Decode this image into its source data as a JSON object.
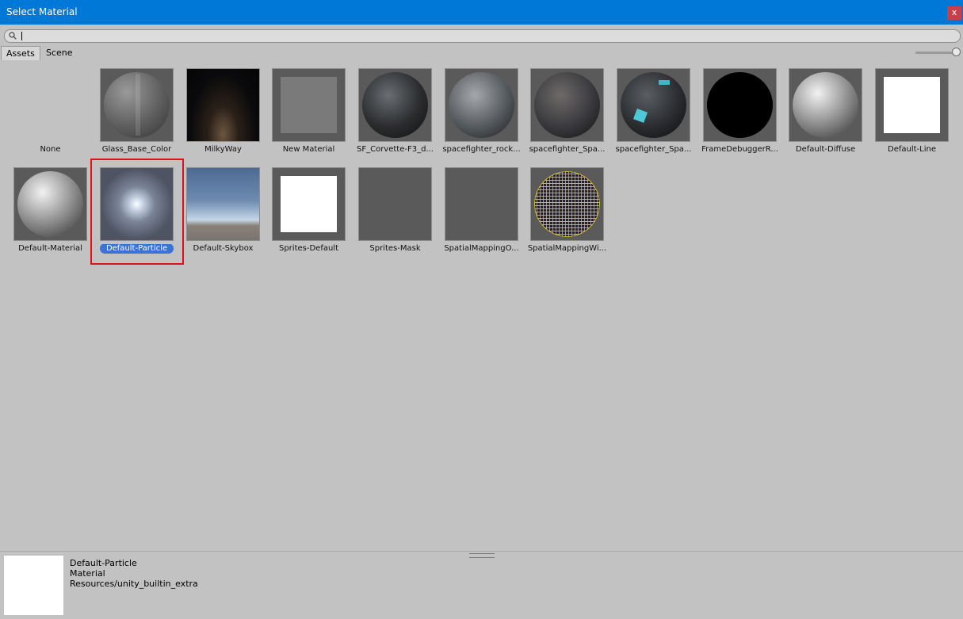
{
  "window": {
    "title": "Select Material",
    "close_label": "x"
  },
  "search": {
    "value": "",
    "placeholder": ""
  },
  "tabs": [
    {
      "label": "Assets",
      "active": true
    },
    {
      "label": "Scene",
      "active": false
    }
  ],
  "zoom_level": 1.0,
  "assets": [
    {
      "label": "None",
      "thumb": "none"
    },
    {
      "label": "Glass_Base_Color",
      "thumb": "sphere-gray-striped"
    },
    {
      "label": "MilkyWay",
      "thumb": "milkyway"
    },
    {
      "label": "New Material",
      "thumb": "flat-gray-square"
    },
    {
      "label": "SF_Corvette-F3_d...",
      "thumb": "sphere-dark-metal"
    },
    {
      "label": "spacefighter_rock...",
      "thumb": "sphere-metal-panels"
    },
    {
      "label": "spacefighter_Spa...",
      "thumb": "sphere-dark-tech"
    },
    {
      "label": "spacefighter_Spa...",
      "thumb": "sphere-dark-tech-cyan"
    },
    {
      "label": "FrameDebuggerR...",
      "thumb": "sphere-black"
    },
    {
      "label": "Default-Diffuse",
      "thumb": "sphere-gray"
    },
    {
      "label": "Default-Line",
      "thumb": "white-square"
    },
    {
      "label": "Default-Material",
      "thumb": "sphere-gray"
    },
    {
      "label": "Default-Particle",
      "thumb": "particle-glow",
      "selected": true
    },
    {
      "label": "Default-Skybox",
      "thumb": "skybox"
    },
    {
      "label": "Sprites-Default",
      "thumb": "white-square"
    },
    {
      "label": "Sprites-Mask",
      "thumb": "blank"
    },
    {
      "label": "SpatialMappingO...",
      "thumb": "blank"
    },
    {
      "label": "SpatialMappingWi...",
      "thumb": "wireframe-yellow-sphere"
    }
  ],
  "selection_info": {
    "name": "Default-Particle",
    "type": "Material",
    "path": "Resources/unity_builtin_extra"
  },
  "colors": {
    "titlebar": "#0078d7",
    "close": "#c8414a",
    "selection": "#3a72d6",
    "highlight": "#e0101a"
  }
}
